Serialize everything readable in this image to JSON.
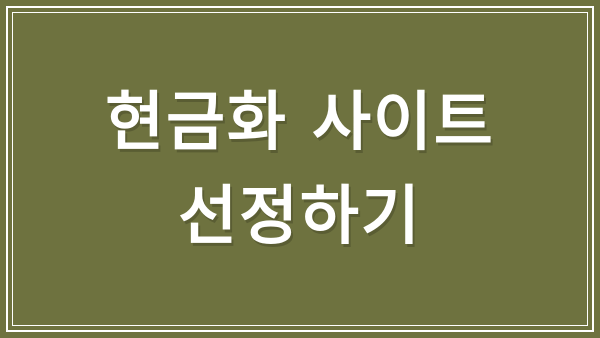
{
  "banner": {
    "background_color": "#6e723f",
    "frame_color": "#ffffff",
    "title_lines": [
      "현금화 사이트",
      "선정하기"
    ]
  }
}
